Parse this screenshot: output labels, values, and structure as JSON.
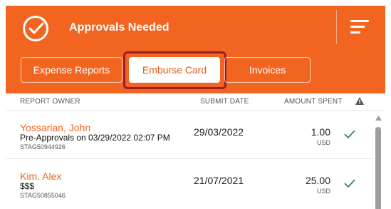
{
  "header": {
    "title": "Approvals Needed",
    "icon": "check-circle-icon",
    "menu_icon": "filter-menu-icon",
    "color": "#f26521"
  },
  "tabs": [
    {
      "label": "Expense Reports",
      "active": false
    },
    {
      "label": "Emburse Card",
      "active": true
    },
    {
      "label": "Invoices",
      "active": false
    }
  ],
  "columns": {
    "owner": "REPORT OWNER",
    "date": "SUBMIT DATE",
    "amount": "AMOUNT SPENT",
    "flag_icon": "warning-icon"
  },
  "rows": [
    {
      "owner": "Yossarian, John",
      "description": "Pre-Approvals on 03/29/2022 02:07 PM",
      "id": "STAG50944926",
      "date": "29/03/2022",
      "amount": "1.00",
      "currency": "USD",
      "status_icon": "check-icon"
    },
    {
      "owner": "Kim. Alex",
      "description": "$$$",
      "id": "STAG50855046",
      "date": "21/07/2021",
      "amount": "25.00",
      "currency": "USD",
      "status_icon": "check-icon"
    }
  ]
}
